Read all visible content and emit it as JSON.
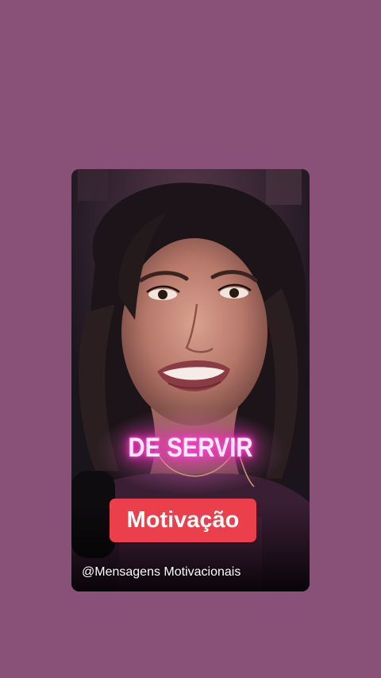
{
  "background_color": "#8a5178",
  "video": {
    "caption": "DE SERVIR",
    "tag_label": "Motivação",
    "tag_color": "#ec3f4c",
    "caption_glow_color": "#ff2bbf",
    "channel_handle": "@Mensagens Motivacionais"
  }
}
